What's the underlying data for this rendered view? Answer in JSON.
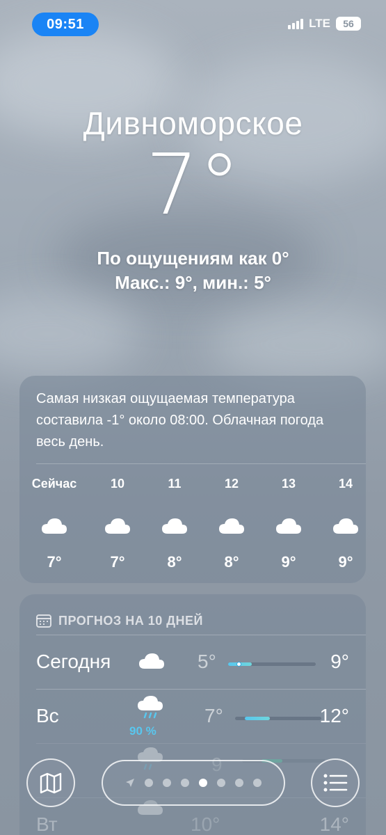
{
  "status_bar": {
    "time": "09:51",
    "network": "LTE",
    "battery": "56"
  },
  "location": {
    "city": "Дивноморское",
    "temperature": "7°",
    "feels_like": "По ощущениям как 0°",
    "min_max": "Макс.: 9°, мин.: 5°"
  },
  "hourly": {
    "summary": "Самая низкая ощущаемая температура составила -1° около 08:00. Облачная погода весь день.",
    "items": [
      {
        "label": "Сейчас",
        "icon": "cloud-icon",
        "temp": "7°"
      },
      {
        "label": "10",
        "icon": "cloud-icon",
        "temp": "7°"
      },
      {
        "label": "11",
        "icon": "cloud-icon",
        "temp": "8°"
      },
      {
        "label": "12",
        "icon": "cloud-icon",
        "temp": "8°"
      },
      {
        "label": "13",
        "icon": "cloud-icon",
        "temp": "9°"
      },
      {
        "label": "14",
        "icon": "cloud-icon",
        "temp": "9°"
      }
    ]
  },
  "daily": {
    "title": "ПРОГНОЗ НА 10 ДНЕЙ",
    "days": [
      {
        "day": "Сегодня",
        "icon": "cloud-icon",
        "precip": "",
        "low": "5°",
        "high": "9°"
      },
      {
        "day": "Вс",
        "icon": "rain-cloud-icon",
        "precip": "90 %",
        "low": "7°",
        "high": "12°"
      },
      {
        "day": "",
        "icon": "rain-cloud-icon",
        "precip": "",
        "low": "9",
        "high": ""
      },
      {
        "day": "Вт",
        "icon": "rain-cloud-icon",
        "precip": "",
        "low": "10°",
        "high": "14°"
      }
    ]
  },
  "colors": {
    "accent": "#1a84f5",
    "precip": "#58c7ef"
  },
  "nav": {
    "map_icon": "map-icon",
    "list_icon": "list-icon",
    "page_count": 8,
    "active_page": 5
  }
}
